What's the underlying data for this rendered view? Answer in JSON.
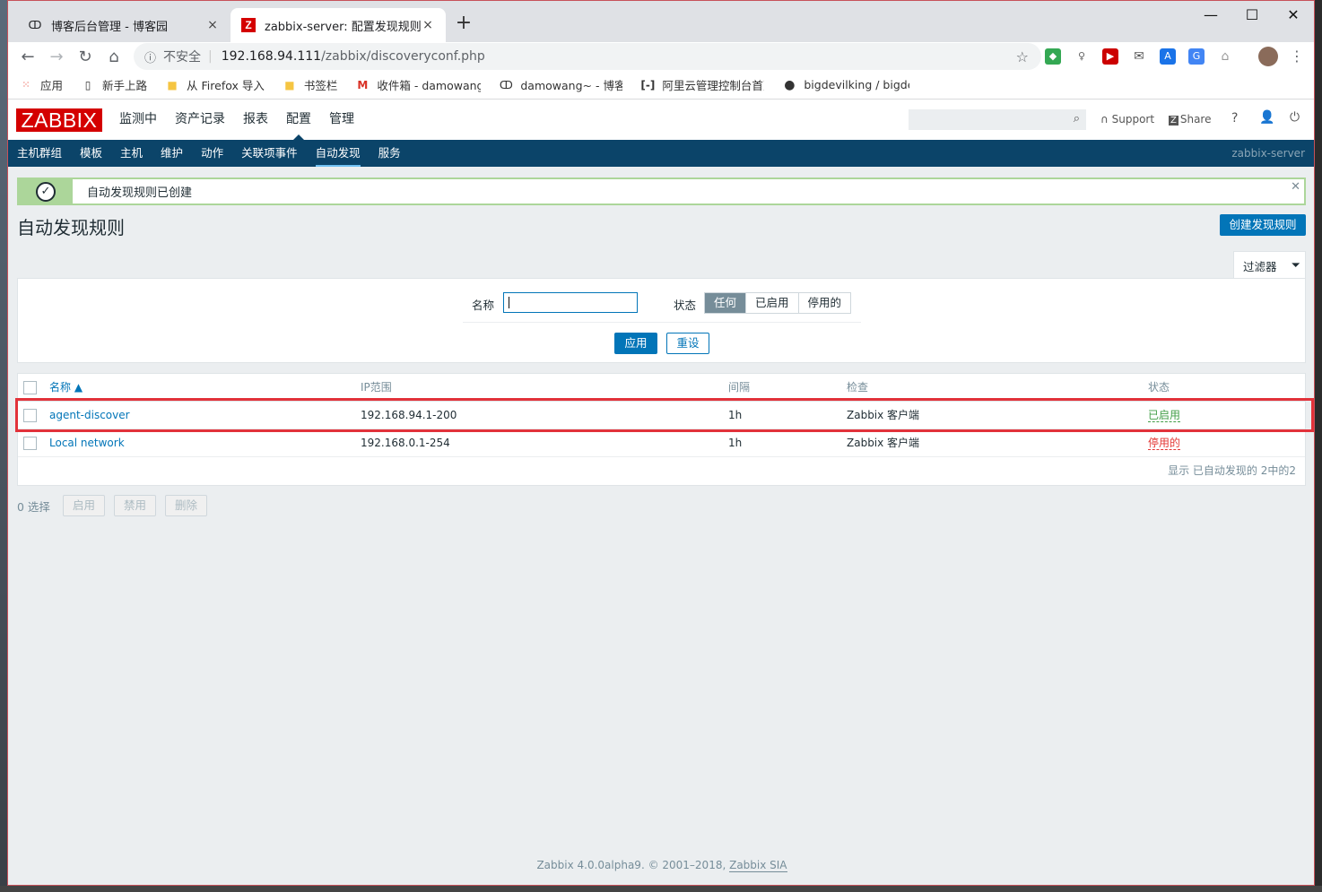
{
  "browser": {
    "tabs": [
      {
        "title": "博客后台管理 - 博客园",
        "icon": "cnblogs-icon",
        "close": "×"
      },
      {
        "title": "zabbix-server: 配置发现规则",
        "icon": "zabbix-favicon",
        "icon_text": "Z",
        "close": "×"
      }
    ],
    "new_tab": "+",
    "window_controls": {
      "minimize": "—",
      "maximize": "☐",
      "close": "✕"
    },
    "omnibox": {
      "security": "不安全",
      "host": "192.168.94.111",
      "path": "/zabbix/discoveryconf.php"
    },
    "bookmarks": [
      {
        "label": "应用",
        "icon": "apps-grid-icon"
      },
      {
        "label": "新手上路",
        "icon": "page-icon"
      },
      {
        "label": "从 Firefox 导入",
        "icon": "folder-icon"
      },
      {
        "label": "书签栏",
        "icon": "folder-icon"
      },
      {
        "label": "收件箱 - damowang",
        "icon": "gmail-icon"
      },
      {
        "label": "damowang~ - 博客园",
        "icon": "cnblogs-icon"
      },
      {
        "label": "阿里云管理控制台首页",
        "icon": "aliyun-icon"
      },
      {
        "label": "bigdevilking / bigdevilking",
        "icon": "github-icon"
      }
    ]
  },
  "zabbix": {
    "logo": "ZABBIX",
    "top_menu": [
      "监测中",
      "资产记录",
      "报表",
      "配置",
      "管理"
    ],
    "top_menu_selected": "配置",
    "header_links": {
      "support": "Support",
      "share": "Share",
      "help": "?"
    },
    "sub_menu": [
      "主机群组",
      "模板",
      "主机",
      "维护",
      "动作",
      "关联项事件",
      "自动发现",
      "服务"
    ],
    "sub_menu_selected": "自动发现",
    "server_name": "zabbix-server",
    "message": "自动发现规则已创建",
    "page_title": "自动发现规则",
    "create_button": "创建发现规则",
    "filter": {
      "tab_label": "过滤器",
      "name_label": "名称",
      "name_value": "",
      "status_label": "状态",
      "status_options": [
        "任何",
        "已启用",
        "停用的"
      ],
      "status_selected": "任何",
      "apply": "应用",
      "reset": "重设"
    },
    "table": {
      "headers": {
        "name": "名称 ▲",
        "ip": "IP范围",
        "interval": "间隔",
        "checks": "检查",
        "status": "状态"
      },
      "rows": [
        {
          "name": "agent-discover",
          "ip": "192.168.94.1-200",
          "interval": "1h",
          "checks": "Zabbix 客户端",
          "status": "已启用"
        },
        {
          "name": "Local network",
          "ip": "192.168.0.1-254",
          "interval": "1h",
          "checks": "Zabbix 客户端",
          "status": "停用的"
        }
      ],
      "footer": "显示 已自动发现的 2中的2"
    },
    "actions": {
      "selected": "0 选择",
      "enable": "启用",
      "disable": "禁用",
      "delete": "删除"
    },
    "footer": {
      "text": "Zabbix 4.0.0alpha9. © 2001–2018, ",
      "link": "Zabbix SIA"
    }
  },
  "colors": {
    "zabbix_red": "#d40000",
    "nav_blue": "#0b4469",
    "link_blue": "#0275b8",
    "enabled_green": "#429e47",
    "disabled_red": "#e33734",
    "highlight_red": "#e2323a"
  }
}
